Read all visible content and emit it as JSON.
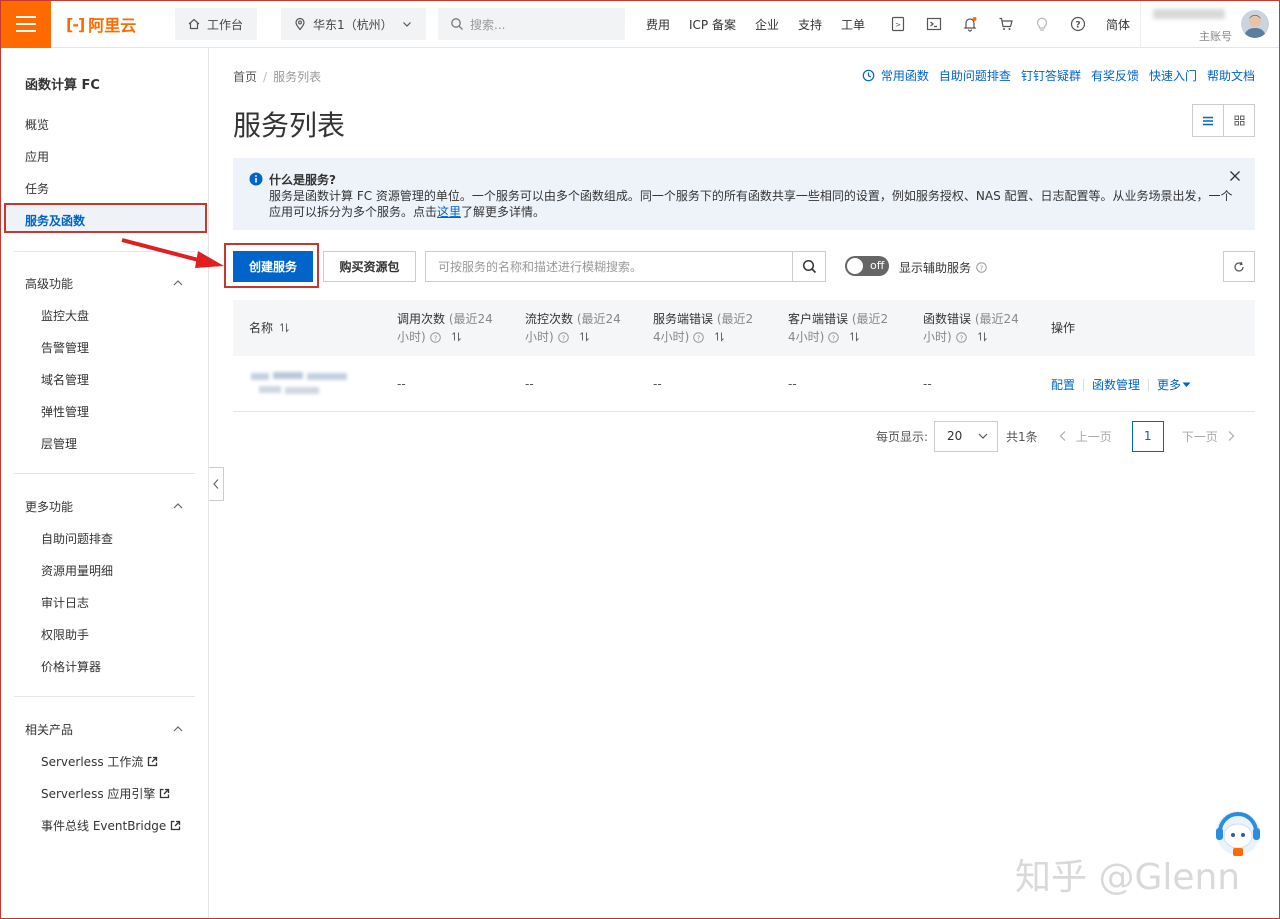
{
  "topbar": {
    "logo_mark": "[-]",
    "logo_text": "阿里云",
    "workbench": "工作台",
    "region": "华东1（杭州）",
    "search_placeholder": "搜索...",
    "links": [
      "费用",
      "ICP 备案",
      "企业",
      "支持",
      "工单"
    ],
    "lang": "简体",
    "account_label": "主账号"
  },
  "sidebar": {
    "title": "函数计算 FC",
    "items": [
      "概览",
      "应用",
      "任务"
    ],
    "active": "服务及函数",
    "group_advanced": "高级功能",
    "advanced_items": [
      "监控大盘",
      "告警管理",
      "域名管理",
      "弹性管理",
      "层管理"
    ],
    "group_more": "更多功能",
    "more_items": [
      "自助问题排查",
      "资源用量明细",
      "审计日志",
      "权限助手",
      "价格计算器"
    ],
    "group_related": "相关产品",
    "related_items": [
      "Serverless 工作流",
      "Serverless 应用引擎",
      "事件总线 EventBridge"
    ]
  },
  "breadcrumb": {
    "home": "首页",
    "sep": "/",
    "current": "服务列表"
  },
  "help_links": [
    "常用函数",
    "自助问题排查",
    "钉钉答疑群",
    "有奖反馈",
    "快速入门",
    "帮助文档"
  ],
  "page_title": "服务列表",
  "notice": {
    "title": "什么是服务?",
    "body_pre": "服务是函数计算 FC 资源管理的单位。一个服务可以由多个函数组成。同一个服务下的所有函数共享一些相同的设置，例如服务授权、NAS 配置、日志配置等。从业务场景出发，一个应用可以拆分为多个服务。点击",
    "link": "这里",
    "body_post": "了解更多详情。"
  },
  "toolbar": {
    "create": "创建服务",
    "buy": "购买资源包",
    "search_placeholder": "可按服务的名称和描述进行模糊搜索。",
    "toggle_state": "off",
    "toggle_label": "显示辅助服务"
  },
  "table": {
    "headers": {
      "name": "名称",
      "invocations": "调用次数",
      "invocations_hint_a": "(最近24",
      "invocations_hint_b": "小时)",
      "throttles": "流控次数",
      "throttles_hint_a": "(最近24",
      "throttles_hint_b": "小时)",
      "server_errors": "服务端错误",
      "server_errors_hint_a": "(最近2",
      "server_errors_hint_b": "4小时)",
      "client_errors": "客户端错误",
      "client_errors_hint_a": "(最近2",
      "client_errors_hint_b": "4小时)",
      "func_errors": "函数错误",
      "func_errors_hint_a": "(最近24",
      "func_errors_hint_b": "小时)",
      "actions": "操作"
    },
    "rows": [
      {
        "invocations": "--",
        "throttles": "--",
        "server_errors": "--",
        "client_errors": "--",
        "func_errors": "--",
        "action_config": "配置",
        "action_functions": "函数管理",
        "action_more": "更多"
      }
    ]
  },
  "pagination": {
    "per_page_label": "每页显示:",
    "per_page": "20",
    "total": "共1条",
    "prev": "上一页",
    "current": "1",
    "next": "下一页"
  },
  "watermark": "知乎 @Glenn",
  "colors": {
    "brand": "#ff6a00",
    "primary": "#0064c8",
    "highlight": "#c7372f"
  }
}
